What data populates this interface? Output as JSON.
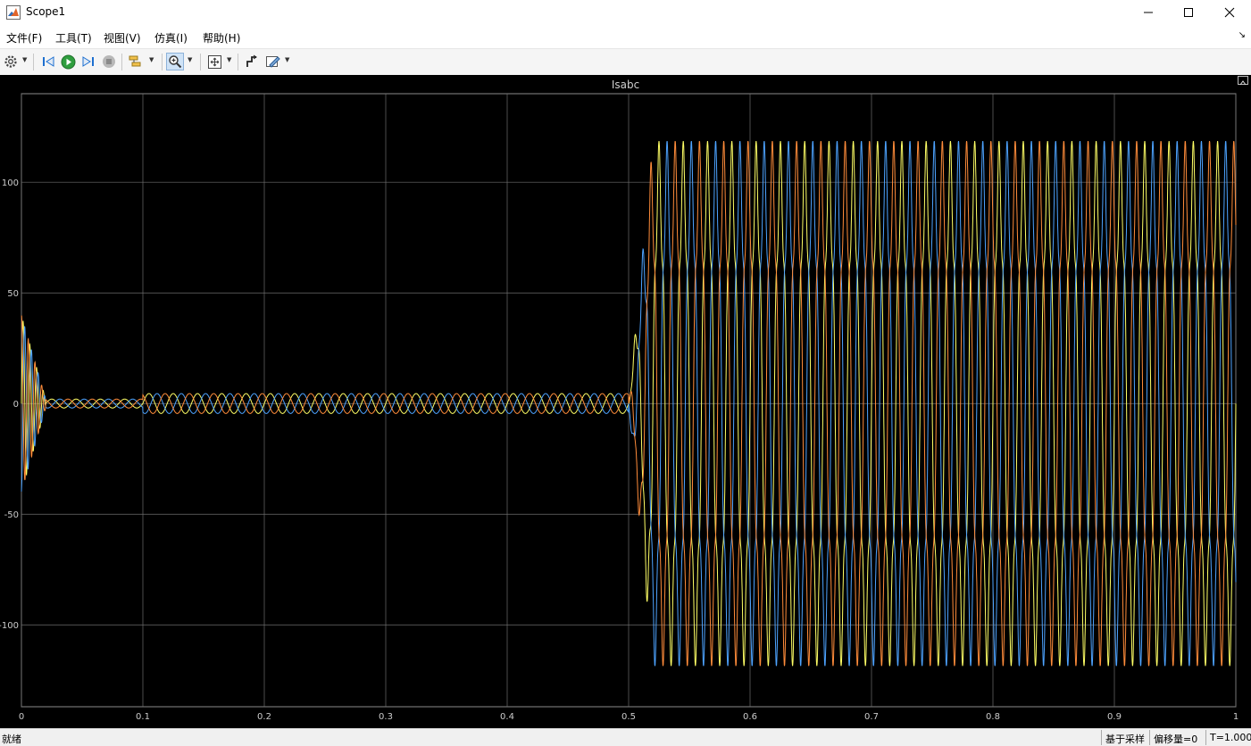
{
  "window": {
    "title": "Scope1"
  },
  "menu": [
    "文件(F)",
    "工具(T)",
    "视图(V)",
    "仿真(I)",
    "帮助(H)"
  ],
  "menu_right_glyph": "↘",
  "toolbar": {
    "icons": [
      "gear-icon",
      "step-back-icon",
      "run-icon",
      "step-forward-icon",
      "stop-icon",
      "signal-highlight-icon",
      "zoom-in-icon",
      "autoscale-icon",
      "cursor-measure-icon",
      "style-icon"
    ]
  },
  "plot": {
    "title": "Isabc",
    "colors": {
      "background": "#000000",
      "grid": "#6e6e6e",
      "axis_text": "#cccccc",
      "phase_a": "#ffff66",
      "phase_b": "#4da3ff",
      "phase_c": "#ff8c3a"
    }
  },
  "chart_data": {
    "type": "line",
    "title": "Isabc",
    "xlabel": "",
    "ylabel": "",
    "xlim": [
      0,
      1
    ],
    "ylim": [
      -137,
      140
    ],
    "xticks": [
      0,
      0.1,
      0.2,
      0.3,
      0.4,
      0.5,
      0.6,
      0.7,
      0.8,
      0.9,
      1
    ],
    "xtick_labels": [
      "0",
      "0.1",
      "0.2",
      "0.3",
      "0.4",
      "0.5",
      "0.6",
      "0.7",
      "0.8",
      "0.9",
      "1"
    ],
    "yticks": [
      100,
      50,
      0,
      -50,
      -100
    ],
    "ytick_labels": [
      "100",
      "50",
      "0",
      "-50",
      "-100"
    ],
    "grid": true,
    "frequency_hz": 50,
    "segments": [
      {
        "t_start": 0.0,
        "t_end": 0.02,
        "description_amplitude": 40
      },
      {
        "t_start": 0.02,
        "t_end": 0.1,
        "amplitude": 2
      },
      {
        "t_start": 0.1,
        "t_end": 0.5,
        "amplitude": 4.5
      },
      {
        "t_start": 0.5,
        "t_end": 1.0,
        "amplitude": 108
      }
    ],
    "series": [
      {
        "color": "#ffff66",
        "phase_deg": 0
      },
      {
        "color": "#4da3ff",
        "phase_deg": -120
      },
      {
        "color": "#ff8c3a",
        "phase_deg": 120
      }
    ]
  },
  "status": {
    "left": "就绪",
    "cells": [
      "基于采样",
      "偏移量=0",
      "T=1.000"
    ]
  }
}
